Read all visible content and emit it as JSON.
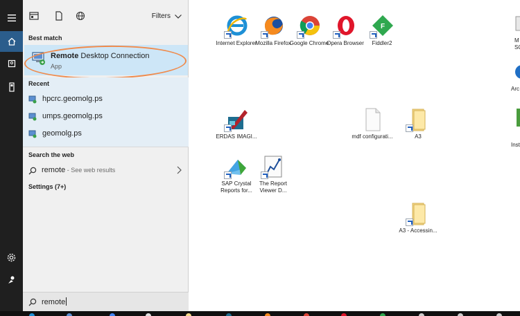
{
  "rail": {
    "icons": [
      "hamburger-icon",
      "home-icon",
      "document-icon",
      "device-icon",
      "settings-gear-icon",
      "user-icon"
    ],
    "accent": "#2b5d8c"
  },
  "panel": {
    "tabs": [
      "apps-icon",
      "documents-icon",
      "web-icon"
    ],
    "filters_label": "Filters",
    "best_match_header": "Best match",
    "best_match": {
      "title_bold": "Remote",
      "title_rest": " Desktop Connection",
      "subtitle": "App",
      "highlight_color": "#cde6f7",
      "annotation_color": "#f08a4b"
    },
    "recent_header": "Recent",
    "recent_items": [
      "hpcrc.geomolg.ps",
      "umps.geomolg.ps",
      "geomolg.ps"
    ],
    "search_web_header": "Search the web",
    "web_query": "remote",
    "web_suffix": " - See web results",
    "settings_label": "Settings (7+)",
    "search_box_value": "remote"
  },
  "desktop": {
    "icons": [
      {
        "label": "Internet Explorer",
        "kind": "ie-icon"
      },
      {
        "label": "Mozilla Firefox",
        "kind": "firefox-icon"
      },
      {
        "label": "Google Chrome",
        "kind": "chrome-icon"
      },
      {
        "label": "Opera Browser",
        "kind": "opera-icon"
      },
      {
        "label": "Fiddler2",
        "kind": "fiddler-icon"
      },
      {
        "label": "ERDAS IMAGI...",
        "kind": "erdas-icon"
      },
      {
        "label": "mdf configurati...",
        "kind": "file-icon"
      },
      {
        "label": "A3",
        "kind": "folder-icon"
      },
      {
        "label": "SAP Crystal Reports for...",
        "kind": "sap-crystal-icon"
      },
      {
        "label": "The Report Viewer D...",
        "kind": "report-viewer-icon"
      },
      {
        "label": "A3 - Accessin...",
        "kind": "folder-icon"
      },
      {
        "label": "M SQL",
        "kind": "app-icon"
      },
      {
        "label": "Arc M",
        "kind": "app-icon"
      },
      {
        "label": "Inst",
        "kind": "app-icon"
      }
    ]
  }
}
